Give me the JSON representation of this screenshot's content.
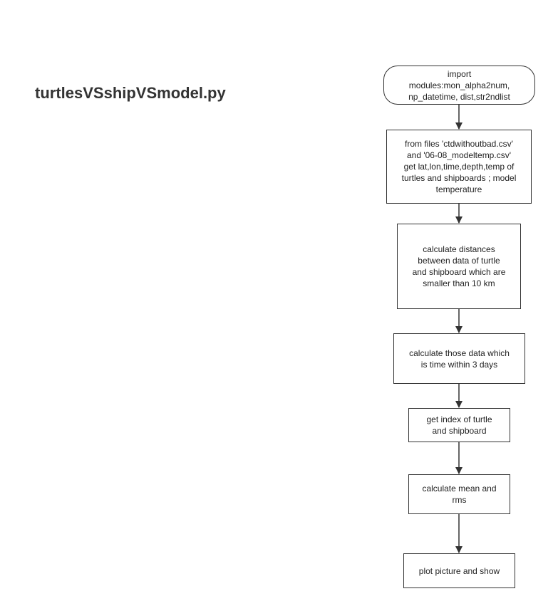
{
  "title": "turtlesVSshipVSmodel.py",
  "nodes": [
    {
      "id": "import",
      "label": "import\nmodules:mon_alpha2num,\nnp_datetime, dist,str2ndlist"
    },
    {
      "id": "from-files",
      "label": "from files 'ctdwithoutbad.csv'\nand '06-08_modeltemp.csv'\nget lat,lon,time,depth,temp of\nturtles and shipboards ; model\ntemperature"
    },
    {
      "id": "calc-distances",
      "label": "calculate distances\nbetween data of turtle\nand shipboard which are\nsmaller than 10 km"
    },
    {
      "id": "calc-time",
      "label": "calculate those data which\nis time within 3 days"
    },
    {
      "id": "get-index",
      "label": "get index of turtle\nand shipboard"
    },
    {
      "id": "calc-mean",
      "label": "calculate mean and\nrms"
    },
    {
      "id": "plot",
      "label": "plot picture and show"
    }
  ],
  "edges": [
    [
      "import",
      "from-files"
    ],
    [
      "from-files",
      "calc-distances"
    ],
    [
      "calc-distances",
      "calc-time"
    ],
    [
      "calc-time",
      "get-index"
    ],
    [
      "get-index",
      "calc-mean"
    ],
    [
      "calc-mean",
      "plot"
    ]
  ]
}
